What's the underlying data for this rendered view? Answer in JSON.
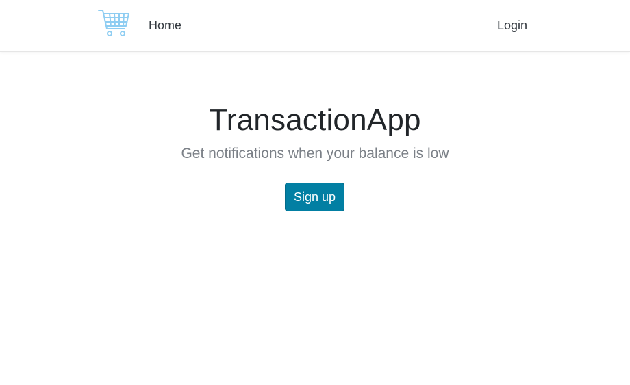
{
  "navbar": {
    "brand_icon": "shopping-cart-icon",
    "brand_icon_color": "#8ecdf2",
    "home_label": "Home",
    "login_label": "Login"
  },
  "hero": {
    "title": "TransactionApp",
    "subtitle": "Get notifications when your balance is low",
    "signup_label": "Sign up",
    "signup_color": "#027fa3"
  }
}
